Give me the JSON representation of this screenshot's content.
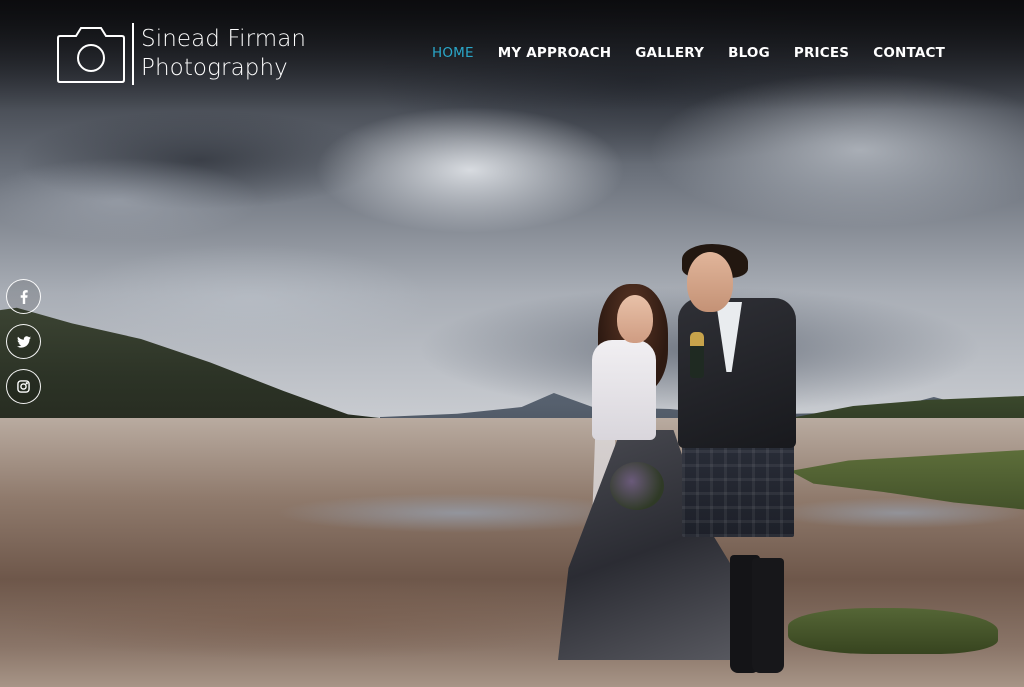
{
  "brand": {
    "line1": "Sinead Firman",
    "line2": "Photography",
    "icon": "camera-icon",
    "color": "#ffffff"
  },
  "nav": {
    "active_color": "#2aa7c9",
    "items": [
      {
        "label": "HOME",
        "active": true
      },
      {
        "label": "MY APPROACH",
        "active": false
      },
      {
        "label": "GALLERY",
        "active": false
      },
      {
        "label": "BLOG",
        "active": false
      },
      {
        "label": "PRICES",
        "active": false
      },
      {
        "label": "CONTACT",
        "active": false
      }
    ]
  },
  "social": [
    {
      "icon": "facebook-icon"
    },
    {
      "icon": "twitter-icon"
    },
    {
      "icon": "instagram-icon"
    }
  ],
  "hero": {
    "image": "wedding-couple-beach-photo"
  }
}
